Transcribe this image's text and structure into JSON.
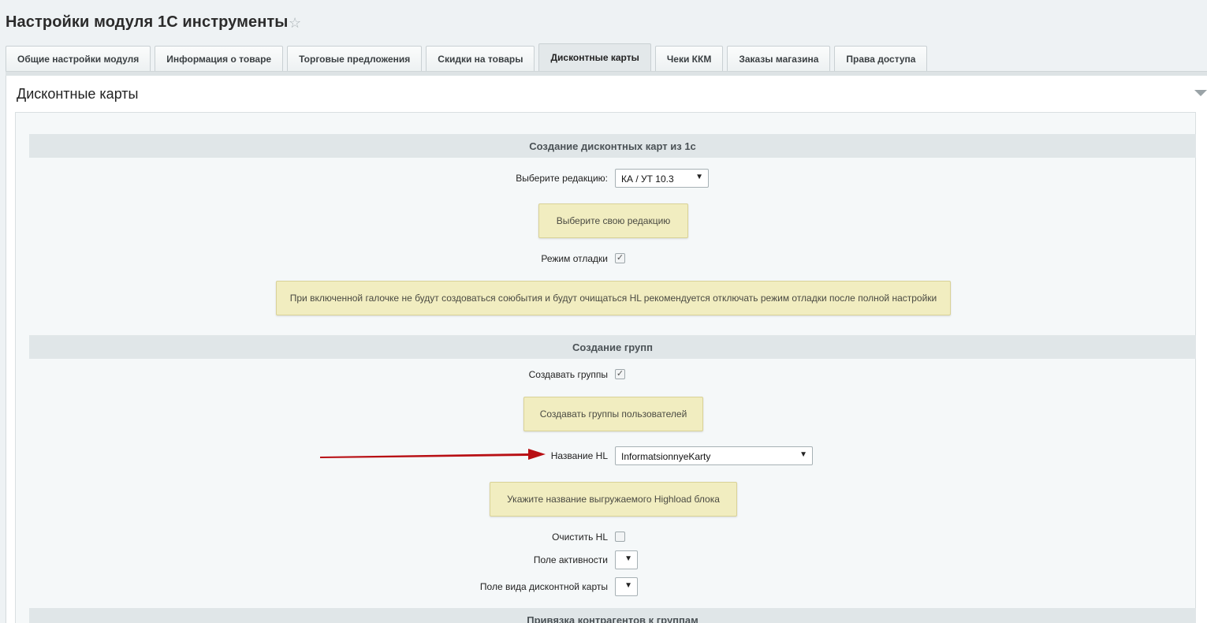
{
  "page": {
    "title": "Настройки модуля 1С инструменты"
  },
  "tabs": [
    {
      "label": "Общие настройки модуля"
    },
    {
      "label": "Информация о товаре"
    },
    {
      "label": "Торговые предложения"
    },
    {
      "label": "Скидки на товары"
    },
    {
      "label": "Дисконтные карты",
      "active": true
    },
    {
      "label": "Чеки ККМ"
    },
    {
      "label": "Заказы магазина"
    },
    {
      "label": "Права доступа"
    }
  ],
  "panel": {
    "title": "Дисконтные карты"
  },
  "section1": {
    "heading": "Создание дисконтных карт из 1с",
    "edition_label": "Выберите редакцию:",
    "edition_value": "КА / УТ 10.3",
    "edition_note": "Выберите свою редакцию",
    "debug_label": "Режим отладки",
    "debug_checked": true,
    "debug_note": "При включенной галочке не будут создоваться союбытия и будут очищаться HL рекомендуется отключать режим отладки после полной настройки"
  },
  "section2": {
    "heading": "Создание групп",
    "create_groups_label": "Создавать группы",
    "create_groups_checked": true,
    "create_groups_note": "Создавать группы пользователей",
    "hl_name_label": "Название HL",
    "hl_name_value": "InformatsionnyeKarty",
    "hl_note": "Укажите название выгружаемого Highload блока",
    "clear_hl_label": "Очистить HL",
    "clear_hl_checked": false,
    "active_field_label": "Поле активности",
    "active_field_value": "",
    "card_type_label": "Поле вида дисконтной карты",
    "card_type_value": ""
  },
  "section3": {
    "heading": "Привязка контрагентов к группам"
  },
  "icons": {
    "star": "star-icon",
    "dropdown": "chevron-down-icon",
    "collapse": "collapse-triangle-icon",
    "arrow": "red-arrow-annotation"
  },
  "colors": {
    "note_bg": "#f1edc0",
    "arrow": "#b80f14"
  }
}
